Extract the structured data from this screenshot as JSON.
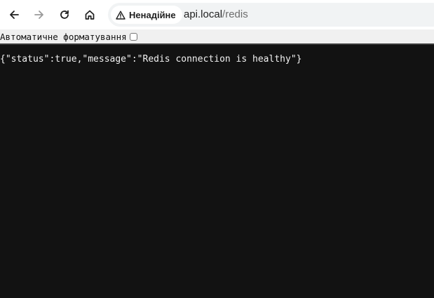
{
  "toolbar": {
    "back_icon": "arrow-left-icon",
    "forward_icon": "arrow-right-icon",
    "reload_icon": "reload-icon",
    "home_icon": "home-icon"
  },
  "omnibox": {
    "security_label": "Ненадійне",
    "security_icon": "warning-triangle-icon",
    "url_host": "api.local",
    "url_path": "/redis"
  },
  "pretty_print": {
    "label": "Автоматичне форматування",
    "checked": false
  },
  "body": {
    "json_text": "{\"status\":true,\"message\":\"Redis connection is healthy\"}"
  }
}
